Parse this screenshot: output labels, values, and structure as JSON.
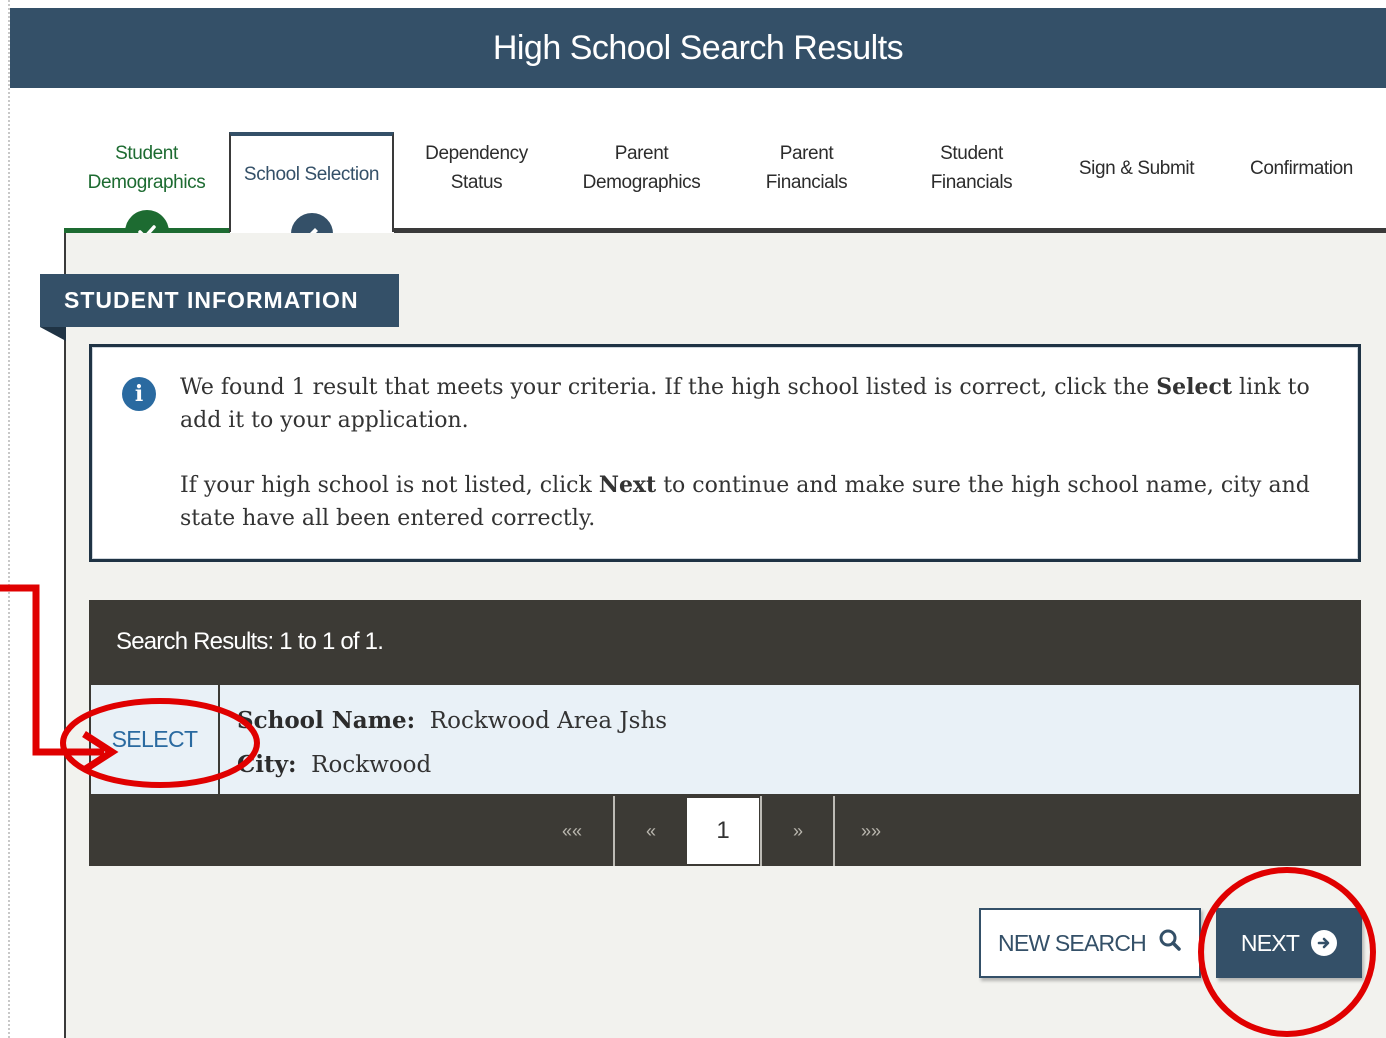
{
  "header": {
    "title": "High School Search Results"
  },
  "steps": [
    {
      "label_line1": "Student",
      "label_line2": "Demographics",
      "state": "complete"
    },
    {
      "label_line1": "School Selection",
      "label_line2": "",
      "state": "active"
    },
    {
      "label_line1": "Dependency",
      "label_line2": "Status",
      "state": "upcoming"
    },
    {
      "label_line1": "Parent",
      "label_line2": "Demographics",
      "state": "upcoming"
    },
    {
      "label_line1": "Parent",
      "label_line2": "Financials",
      "state": "upcoming"
    },
    {
      "label_line1": "Student",
      "label_line2": "Financials",
      "state": "upcoming"
    },
    {
      "label_line1": "Sign & Submit",
      "label_line2": "",
      "state": "upcoming"
    },
    {
      "label_line1": "Confirmation",
      "label_line2": "",
      "state": "upcoming"
    }
  ],
  "section": {
    "label": "STUDENT INFORMATION"
  },
  "info": {
    "p1_before": "We found 1 result that meets your criteria. If the high school listed is correct, click the ",
    "p1_bold": "Select",
    "p1_after": " link to add it to your application.",
    "p2_before": "If your high school is not listed, click ",
    "p2_bold": "Next",
    "p2_after": " to continue and make sure the high school name, city and state have all been entered correctly."
  },
  "results": {
    "heading": "Search Results: 1 to 1 of 1.",
    "rows": [
      {
        "action_label": "SELECT",
        "name_label": "School Name:",
        "name": "Rockwood Area Jshs",
        "city_label": "City:",
        "city": "Rockwood"
      }
    ]
  },
  "pagination": {
    "first": "««",
    "prev": "«",
    "current": "1",
    "next": "»",
    "last": "»»"
  },
  "buttons": {
    "new_search": "NEW SEARCH",
    "next": "NEXT"
  },
  "colors": {
    "brand": "#345068",
    "complete": "#1d6b31",
    "annotation": "#e00000"
  },
  "icons": {
    "complete": "check-icon",
    "active": "pencil-icon",
    "info": "info-icon",
    "search": "search-icon",
    "next": "arrow-right-circle-icon"
  }
}
